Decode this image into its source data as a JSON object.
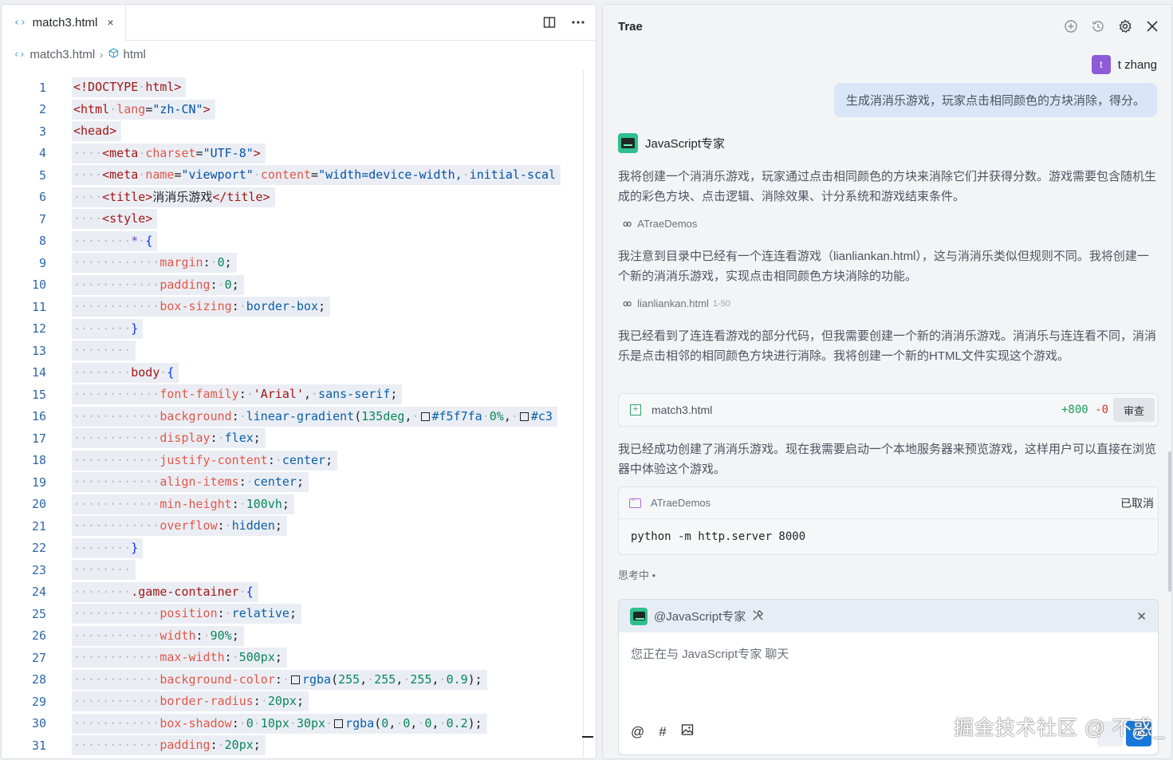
{
  "editor": {
    "tab": {
      "label": "match3.html",
      "icon": "code-icon",
      "close": "×"
    },
    "breadcrumb": {
      "file": "match3.html",
      "node": "html"
    },
    "lines": [
      {
        "n": "1",
        "h": "<span class=\"tag\">&lt;!DOCTYPE</span><span class=\"ws\">·</span><span class=\"tag\">html&gt;</span>"
      },
      {
        "n": "2",
        "h": "<span class=\"tag\">&lt;html</span><span class=\"ws\">·</span><span class=\"attr\">lang</span>=<span class=\"str\">\"zh-CN\"</span><span class=\"tag\">&gt;</span>"
      },
      {
        "n": "3",
        "h": "<span class=\"tag\">&lt;head&gt;</span>"
      },
      {
        "n": "4",
        "h": "<span class=\"ws\">····</span><span class=\"tag\">&lt;meta</span><span class=\"ws\">·</span><span class=\"attr\">charset</span>=<span class=\"str\">\"UTF-8\"</span><span class=\"tag\">&gt;</span>"
      },
      {
        "n": "5",
        "h": "<span class=\"ws\">····</span><span class=\"tag\">&lt;meta</span><span class=\"ws\">·</span><span class=\"attr\">name</span>=<span class=\"str\">\"viewport\"</span><span class=\"ws\">·</span><span class=\"attr\">content</span>=<span class=\"str\">\"width=device-width,</span><span class=\"ws\">·</span><span class=\"str\">initial-scal</span>"
      },
      {
        "n": "6",
        "h": "<span class=\"ws\">····</span><span class=\"tag\">&lt;title&gt;</span>消消乐游戏<span class=\"tag\">&lt;/title&gt;</span>"
      },
      {
        "n": "7",
        "h": "<span class=\"ws\">····</span><span class=\"tag\">&lt;style&gt;</span>"
      },
      {
        "n": "8",
        "h": "<span class=\"ws\">········</span><span class=\"sel\">*</span><span class=\"ws\">·</span><span class=\"br\">{</span>"
      },
      {
        "n": "9",
        "h": "<span class=\"ws\">············</span><span class=\"prop\">margin</span>:<span class=\"ws\">·</span><span class=\"num\">0</span>;"
      },
      {
        "n": "10",
        "h": "<span class=\"ws\">············</span><span class=\"prop\">padding</span>:<span class=\"ws\">·</span><span class=\"num\">0</span>;"
      },
      {
        "n": "11",
        "h": "<span class=\"ws\">············</span><span class=\"prop\">box-sizing</span>:<span class=\"ws\">·</span><span class=\"val\">border-box</span>;"
      },
      {
        "n": "12",
        "h": "<span class=\"ws\">········</span><span class=\"br\">}</span>"
      },
      {
        "n": "13",
        "h": "<span class=\"ws\">········</span>"
      },
      {
        "n": "14",
        "h": "<span class=\"ws\">········</span><span class=\"tag\">body</span><span class=\"ws\">·</span><span class=\"br\">{</span>"
      },
      {
        "n": "15",
        "h": "<span class=\"ws\">············</span><span class=\"prop\">font-family</span>:<span class=\"ws\">·</span><span class=\"tag\">'Arial'</span>,<span class=\"ws\">·</span><span class=\"val\">sans-serif</span>;"
      },
      {
        "n": "16",
        "h": "<span class=\"ws\">············</span><span class=\"prop\">background</span>:<span class=\"ws\">·</span><span class=\"val\">linear-gradient</span>(<span class=\"num\">135deg</span>,<span class=\"ws\">·</span><span class=\"sq\"></span><span class=\"val\">#f5f7fa</span><span class=\"ws\">·</span><span class=\"num\">0%</span>,<span class=\"ws\">·</span><span class=\"sq\"></span><span class=\"val\">#c3</span>"
      },
      {
        "n": "17",
        "h": "<span class=\"ws\">············</span><span class=\"prop\">display</span>:<span class=\"ws\">·</span><span class=\"val\">flex</span>;"
      },
      {
        "n": "18",
        "h": "<span class=\"ws\">············</span><span class=\"prop\">justify-content</span>:<span class=\"ws\">·</span><span class=\"val\">center</span>;"
      },
      {
        "n": "19",
        "h": "<span class=\"ws\">············</span><span class=\"prop\">align-items</span>:<span class=\"ws\">·</span><span class=\"val\">center</span>;"
      },
      {
        "n": "20",
        "h": "<span class=\"ws\">············</span><span class=\"prop\">min-height</span>:<span class=\"ws\">·</span><span class=\"num\">100vh</span>;"
      },
      {
        "n": "21",
        "h": "<span class=\"ws\">············</span><span class=\"prop\">overflow</span>:<span class=\"ws\">·</span><span class=\"val\">hidden</span>;"
      },
      {
        "n": "22",
        "h": "<span class=\"ws\">········</span><span class=\"br\">}</span>"
      },
      {
        "n": "23",
        "h": "<span class=\"ws\">········</span>"
      },
      {
        "n": "24",
        "h": "<span class=\"ws\">········</span><span class=\"tag\">.game-container</span><span class=\"ws\">·</span><span class=\"br\">{</span>"
      },
      {
        "n": "25",
        "h": "<span class=\"ws\">············</span><span class=\"prop\">position</span>:<span class=\"ws\">·</span><span class=\"val\">relative</span>;"
      },
      {
        "n": "26",
        "h": "<span class=\"ws\">············</span><span class=\"prop\">width</span>:<span class=\"ws\">·</span><span class=\"num\">90%</span>;"
      },
      {
        "n": "27",
        "h": "<span class=\"ws\">············</span><span class=\"prop\">max-width</span>:<span class=\"ws\">·</span><span class=\"num\">500px</span>;"
      },
      {
        "n": "28",
        "h": "<span class=\"ws\">············</span><span class=\"prop\">background-color</span>:<span class=\"ws\">·</span><span class=\"sq\"></span><span class=\"val\">rgba</span>(<span class=\"num\">255</span>,<span class=\"ws\">·</span><span class=\"num\">255</span>,<span class=\"ws\">·</span><span class=\"num\">255</span>,<span class=\"ws\">·</span><span class=\"num\">0.9</span>);"
      },
      {
        "n": "29",
        "h": "<span class=\"ws\">············</span><span class=\"prop\">border-radius</span>:<span class=\"ws\">·</span><span class=\"num\">20px</span>;"
      },
      {
        "n": "30",
        "h": "<span class=\"ws\">············</span><span class=\"prop\">box-shadow</span>:<span class=\"ws\">·</span><span class=\"num\">0</span><span class=\"ws\">·</span><span class=\"num\">10px</span><span class=\"ws\">·</span><span class=\"num\">30px</span><span class=\"ws\">·</span><span class=\"sq\"></span><span class=\"val\">rgba</span>(<span class=\"num\">0</span>,<span class=\"ws\">·</span><span class=\"num\">0</span>,<span class=\"ws\">·</span><span class=\"num\">0</span>,<span class=\"ws\">·</span><span class=\"num\">0.2</span>);"
      },
      {
        "n": "31",
        "h": "<span class=\"ws\">············</span><span class=\"prop\">padding</span>:<span class=\"ws\">·</span><span class=\"num\">20px</span>;"
      }
    ]
  },
  "chat": {
    "title": "Trae",
    "user": {
      "avatar_letter": "t",
      "name": "t zhang",
      "message": "生成消消乐游戏，玩家点击相同颜色的方块消除，得分。"
    },
    "agent": {
      "name": "JavaScript专家"
    },
    "para1": "我将创建一个消消乐游戏，玩家通过点击相同颜色的方块来消除它们并获得分数。游戏需要包含随机生成的彩色方块、点击逻辑、消除效果、计分系统和游戏结束条件。",
    "ref1": {
      "label": "ATraeDemos"
    },
    "para2": "我注意到目录中已经有一个连连看游戏（lianliankan.html），这与消消乐类似但规则不同。我将创建一个新的消消乐游戏，实现点击相同颜色方块消除的功能。",
    "ref2": {
      "label": "lianliankan.html",
      "range": "1-50"
    },
    "para3": "我已经看到了连连看游戏的部分代码，但我需要创建一个新的消消乐游戏。消消乐与连连看不同，消消乐是点击相邻的相同颜色方块进行消除。我将创建一个新的HTML文件实现这个游戏。",
    "file_card": {
      "name": "match3.html",
      "added": "+800",
      "removed": "-0",
      "review": "审查"
    },
    "para4": "我已经成功创建了消消乐游戏。现在我需要启动一个本地服务器来预览游戏，这样用户可以直接在浏览器中体验这个游戏。",
    "terminal": {
      "dir": "ATraeDemos",
      "status": "已取消",
      "command": "python -m http.server 8000"
    },
    "thinking": "思考中 •",
    "composer": {
      "mention": "@JavaScript专家",
      "placeholder": "您正在与 JavaScript专家 聊天"
    },
    "watermark": "掘金技术社区 @ 不惑_"
  },
  "colors": {
    "accent": "#1677d9",
    "user_bubble": "#d8e6f7",
    "agent_avatar": "#2fbf8f",
    "user_avatar": "#8e5bd8",
    "diff_add": "#1a9d55",
    "diff_del": "#d0361d"
  }
}
